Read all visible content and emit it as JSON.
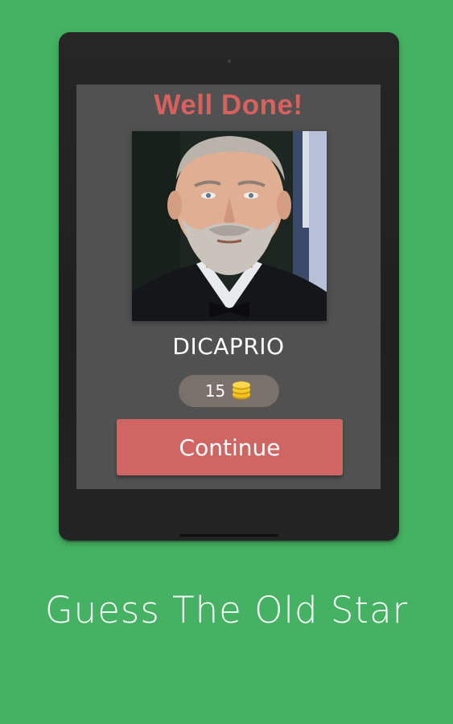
{
  "screen": {
    "title": "Well Done!",
    "answer": "DICAPRIO",
    "coins": "15",
    "continue_label": "Continue",
    "coin_icon": "coins-icon"
  },
  "footer": {
    "app_title": "Guess The Old Star"
  },
  "colors": {
    "background": "#44b262",
    "title": "#d9605d",
    "button": "#cf6664",
    "screen": "#515151",
    "pill": "#7a716c"
  }
}
